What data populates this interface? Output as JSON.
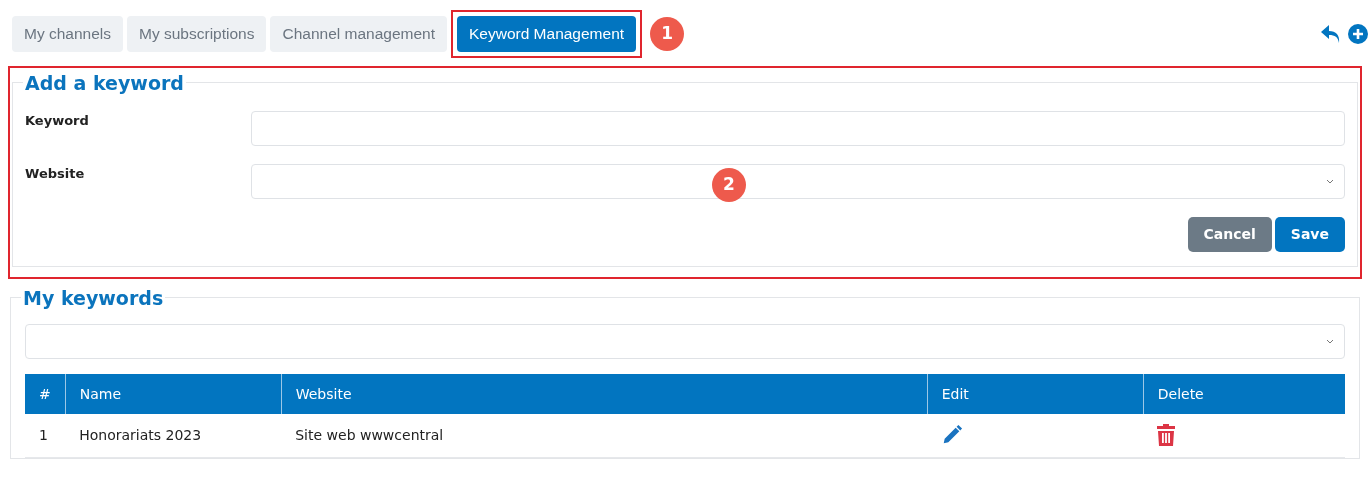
{
  "tabs": [
    {
      "label": "My channels",
      "selected": false
    },
    {
      "label": "My subscriptions",
      "selected": false
    },
    {
      "label": "Channel management",
      "selected": false
    },
    {
      "label": "Keyword Management",
      "selected": true,
      "callout": "1"
    }
  ],
  "add_keyword": {
    "title": "Add a keyword",
    "callout": "2",
    "fields": [
      {
        "kind": "text",
        "label": "Keyword"
      },
      {
        "kind": "select",
        "label": "Website"
      }
    ],
    "buttons": [
      {
        "kind": "secondary",
        "label": "Cancel"
      },
      {
        "kind": "primary",
        "label": "Save"
      }
    ]
  },
  "my_keywords": {
    "title": "My keywords",
    "table": {
      "columns": [
        "#",
        "Name",
        "Website",
        "Edit",
        "Delete"
      ],
      "rows": [
        {
          "number": "1",
          "name": "Honorariats 2023",
          "website": "Site web wwwcentral"
        }
      ]
    }
  }
}
